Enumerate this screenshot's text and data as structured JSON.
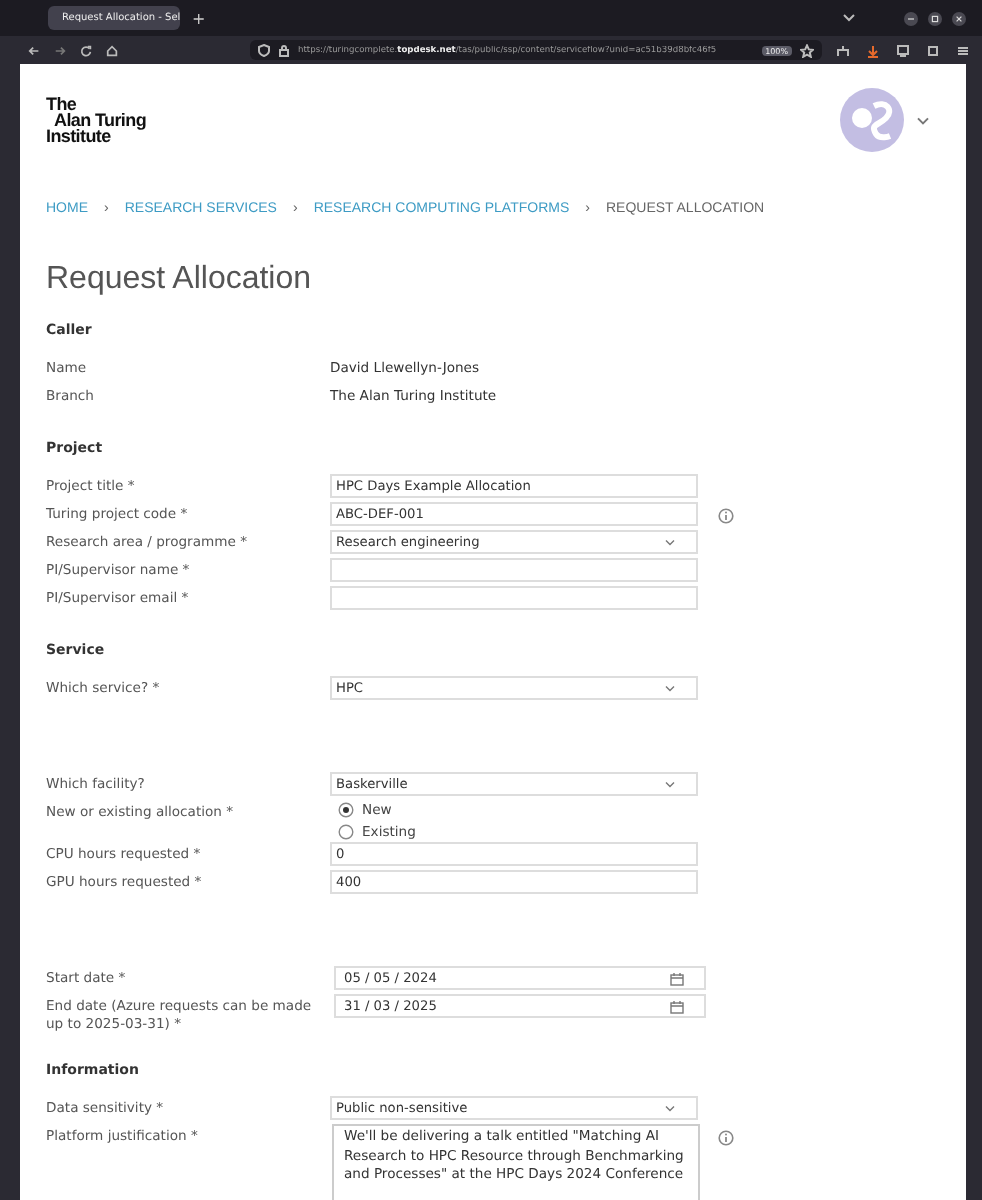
{
  "browser": {
    "tab_title": "Request Allocation - Sel",
    "new_tab": "+",
    "url_prefix": "https://turingcomplete.",
    "url_domain": "topdesk.net",
    "url_path": "/tas/public/ssp/content/serviceflow?unid=ac51b39d8bfc46f5",
    "zoom": "100%"
  },
  "header": {
    "logo_lines": [
      "The",
      "Alan Turing",
      "Institute"
    ]
  },
  "breadcrumb": [
    {
      "label": "HOME",
      "current": false
    },
    {
      "label": "RESEARCH SERVICES",
      "current": false
    },
    {
      "label": "RESEARCH COMPUTING PLATFORMS",
      "current": false
    },
    {
      "label": "REQUEST ALLOCATION",
      "current": true
    }
  ],
  "breadcrumb_separator": "›",
  "title": "Request Allocation",
  "sections": [
    {
      "heading": "Caller",
      "rows": [
        {
          "kind": "text",
          "label": "Name",
          "value": "David Llewellyn-Jones"
        },
        {
          "kind": "text",
          "label": "Branch",
          "value": "The Alan Turing Institute"
        }
      ]
    },
    {
      "heading": "Project",
      "rows": [
        {
          "kind": "input",
          "label": "Project title *",
          "value": "HPC Days Example Allocation"
        },
        {
          "kind": "input",
          "label": "Turing project code *",
          "value": "ABC-DEF-001",
          "info": true
        },
        {
          "kind": "select",
          "label": "Research area / programme *",
          "value": "Research engineering"
        },
        {
          "kind": "input",
          "label": "PI/Supervisor name *"
        },
        {
          "kind": "input",
          "label": "PI/Supervisor email *"
        }
      ]
    },
    {
      "heading": "Service",
      "rows": [
        {
          "kind": "select",
          "label": "Which service? *",
          "value": "HPC"
        },
        {
          "kind": "select",
          "label": "Which facility?",
          "value": "Baskerville",
          "gap_before": true
        },
        {
          "kind": "radio",
          "label": "New or existing allocation *",
          "options": [
            {
              "label": "New",
              "selected": true
            },
            {
              "label": "Existing",
              "selected": false
            }
          ]
        },
        {
          "kind": "input",
          "label": "CPU hours requested *",
          "value": "0"
        },
        {
          "kind": "input",
          "label": "GPU hours requested *",
          "value": "400"
        },
        {
          "kind": "date",
          "label": "Start date *",
          "value": "05 / 05 / 2024",
          "gap_before": true
        },
        {
          "kind": "date",
          "label": "End date (Azure requests can be made up to 2025-03-31) *",
          "value": "31 / 03 / 2025"
        }
      ]
    },
    {
      "heading": "Information",
      "rows": [
        {
          "kind": "select",
          "label": "Data sensitivity *",
          "value": "Public non-sensitive"
        },
        {
          "kind": "textarea",
          "label": "Platform justification *",
          "value": "We'll be delivering a talk entitled \"Matching AI Research to HPC Resource through Benchmarking and Processes\" at the HPC Days 2024 Conference",
          "info": true
        }
      ]
    }
  ]
}
